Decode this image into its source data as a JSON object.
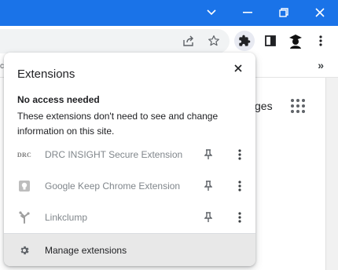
{
  "window": {
    "controls": [
      "chevron-down-icon",
      "minimize-icon",
      "restore-icon",
      "close-icon"
    ],
    "accent_color": "#1a73e8"
  },
  "toolbar": {
    "icons": [
      "share-icon",
      "star-icon",
      "puzzle-icon",
      "side-panel-icon",
      "profile-icon",
      "kebab-menu-icon"
    ]
  },
  "bookmarks": {
    "left_fragment": "c",
    "overflow": "»"
  },
  "page": {
    "partial_text": "ges"
  },
  "extensions_popup": {
    "title": "Extensions",
    "section": {
      "heading": "No access needed",
      "description": "These extensions don't need to see and change information on this site."
    },
    "items": [
      {
        "name": "DRC INSIGHT Secure Extension",
        "icon_text": "DRC"
      },
      {
        "name": "Google Keep Chrome Extension",
        "icon": "keep-bulb-icon"
      },
      {
        "name": "Linkclump",
        "icon": "linkclump-icon"
      }
    ],
    "footer": {
      "manage_label": "Manage extensions"
    }
  }
}
